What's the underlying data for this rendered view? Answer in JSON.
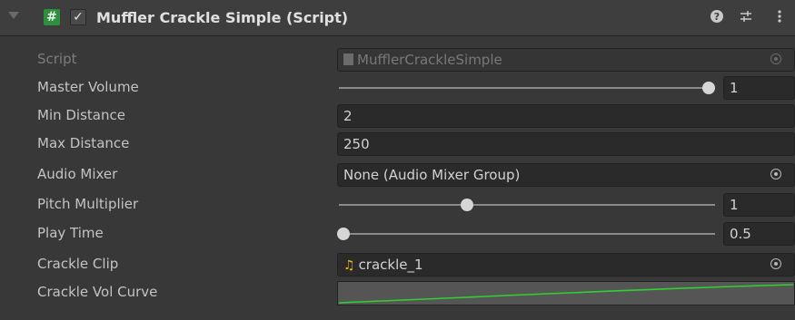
{
  "header": {
    "title": "Muffler Crackle Simple (Script)",
    "script_icon_glyph": "#",
    "enabled_check": "✓",
    "help_icon": "question-icon",
    "presets_icon": "presets-icon",
    "menu_icon": "kebab-menu-icon"
  },
  "fields": {
    "script": {
      "label": "Script",
      "value": "MufflerCrackleSimple"
    },
    "master_volume": {
      "label": "Master Volume",
      "value": "1",
      "slider_fraction": 1.0
    },
    "min_distance": {
      "label": "Min Distance",
      "value": "2"
    },
    "max_distance": {
      "label": "Max Distance",
      "value": "250"
    },
    "audio_mixer": {
      "label": "Audio Mixer",
      "value": "None (Audio Mixer Group)"
    },
    "pitch_multiplier": {
      "label": "Pitch Multiplier",
      "value": "1",
      "slider_fraction": 0.34
    },
    "play_time": {
      "label": "Play Time",
      "value": "0.5",
      "slider_fraction": 0.0
    },
    "crackle_clip": {
      "label": "Crackle Clip",
      "value": "crackle_1"
    },
    "crackle_vol_curve": {
      "label": "Crackle Vol Curve",
      "curve_color": "#2ed12e"
    }
  },
  "colors": {
    "panel_bg": "#383838",
    "header_bg": "#3e3e3e",
    "field_bg": "#2a2a2a",
    "script_icon_green": "#2f8f3d",
    "audio_icon_yellow": "#f2b619"
  }
}
